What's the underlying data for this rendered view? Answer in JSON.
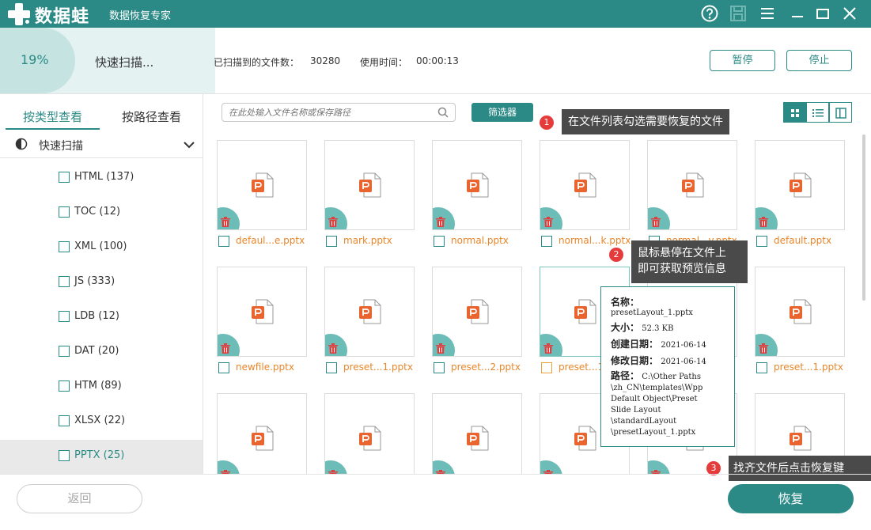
{
  "app": {
    "brand": "数据蛙",
    "subtitle": "数据恢复专家"
  },
  "progress": {
    "percent_text": "19%",
    "percent": 19,
    "status": "快速扫描...",
    "files_label": "已扫描到的文件数：",
    "files_count": "30280",
    "time_label": "使用时间：",
    "time_value": "00:00:13",
    "pause_label": "暂停",
    "stop_label": "停止"
  },
  "sidebar": {
    "tabs": [
      {
        "label": "按类型查看"
      },
      {
        "label": "按路径查看"
      }
    ],
    "section_label": "快速扫描",
    "items": [
      {
        "label": "HTML (137)"
      },
      {
        "label": "TOC (12)"
      },
      {
        "label": "XML (100)"
      },
      {
        "label": "JS (333)"
      },
      {
        "label": "LDB (12)"
      },
      {
        "label": "DAT (20)"
      },
      {
        "label": "HTM (89)"
      },
      {
        "label": "XLSX (22)"
      },
      {
        "label": "PPTX (25)"
      }
    ]
  },
  "toolbar": {
    "search_placeholder": "在此处输入文件名称或保存路径",
    "filter_label": "筛选器"
  },
  "files": [
    {
      "name": "defaul...e.pptx"
    },
    {
      "name": "mark.pptx"
    },
    {
      "name": "normal.pptx"
    },
    {
      "name": "normal...k.pptx"
    },
    {
      "name": "normal...y.pptx"
    },
    {
      "name": "default.pptx"
    },
    {
      "name": "newfile.pptx"
    },
    {
      "name": "preset...1.pptx"
    },
    {
      "name": "preset...2.pptx"
    },
    {
      "name": "preset...1"
    },
    {
      "name": ""
    },
    {
      "name": "preset...1.pptx"
    }
  ],
  "tips": {
    "tip1": {
      "num": "1",
      "text": "在文件列表勾选需要恢复的文件"
    },
    "tip2": {
      "num": "2",
      "line1": "鼠标悬停在文件上",
      "line2": "即可获取预览信息"
    },
    "tip3": {
      "num": "3",
      "text": "找齐文件后点击恢复键"
    }
  },
  "preview": {
    "name_label": "名称：",
    "name_value": "presetLayout_1.pptx",
    "size_label": "大小：",
    "size_value": "52.3 KB",
    "created_label": "创建日期：",
    "created_value": "2021-06-14",
    "modified_label": "修改日期：",
    "modified_value": "2021-06-14",
    "path_label": "路径：",
    "path_line1": "C:\\Other Paths",
    "path_line2": "\\zh_CN\\templates\\Wpp",
    "path_line3": "Default Object\\Preset",
    "path_line4": "Slide Layout",
    "path_line5": "\\standardLayout",
    "path_line6": "\\presetLayout_1.pptx"
  },
  "footer": {
    "back_label": "返回",
    "recover_label": "恢复"
  },
  "colors": {
    "accent": "#2b8a86",
    "file_name": "#e8862a",
    "tip_bg": "#4a4a4a",
    "tip_num": "#e53b3b",
    "ppt_icon": "#e8652f"
  },
  "icons": [
    "help-icon",
    "save-icon",
    "menu-icon",
    "minimize-icon",
    "maximize-icon",
    "close-icon",
    "search-icon",
    "pie-icon",
    "chevron-down-icon",
    "grid-view-icon",
    "list-view-icon",
    "detail-view-icon",
    "pptx-file-icon",
    "trash-icon"
  ]
}
